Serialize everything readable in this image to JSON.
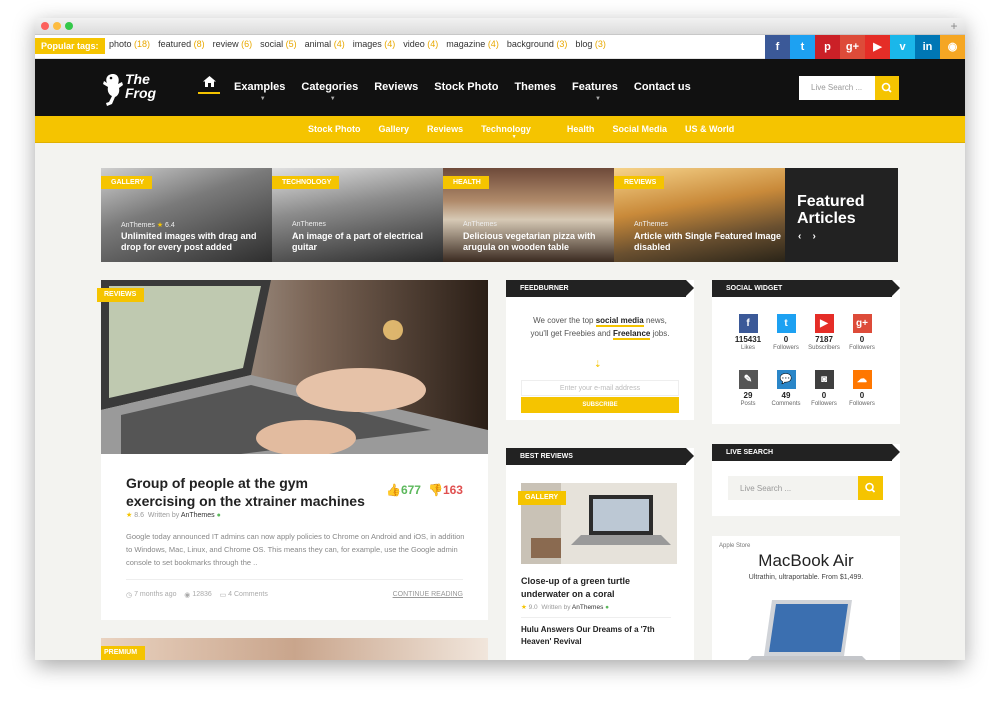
{
  "browser": {
    "new_tab": "+"
  },
  "topbar": {
    "popular_label": "Popular tags:",
    "tags": [
      {
        "name": "photo",
        "count": "(18)"
      },
      {
        "name": "featured",
        "count": "(8)"
      },
      {
        "name": "review",
        "count": "(6)"
      },
      {
        "name": "social",
        "count": "(5)"
      },
      {
        "name": "animal",
        "count": "(4)"
      },
      {
        "name": "images",
        "count": "(4)"
      },
      {
        "name": "video",
        "count": "(4)"
      },
      {
        "name": "magazine",
        "count": "(4)"
      },
      {
        "name": "background",
        "count": "(3)"
      },
      {
        "name": "blog",
        "count": "(3)"
      }
    ],
    "social_icons": [
      {
        "name": "facebook-icon",
        "glyph": "f",
        "color": "#3b5998"
      },
      {
        "name": "twitter-icon",
        "glyph": "t",
        "color": "#1da1f2"
      },
      {
        "name": "pinterest-icon",
        "glyph": "p",
        "color": "#cb2027"
      },
      {
        "name": "google-plus-icon",
        "glyph": "g+",
        "color": "#dd4b39"
      },
      {
        "name": "youtube-icon",
        "glyph": "▶",
        "color": "#e52d27"
      },
      {
        "name": "vimeo-icon",
        "glyph": "v",
        "color": "#1ab7ea"
      },
      {
        "name": "linkedin-icon",
        "glyph": "in",
        "color": "#0077b5"
      },
      {
        "name": "rss-icon",
        "glyph": "◉",
        "color": "#f5a623"
      }
    ]
  },
  "header": {
    "logo_line1": "The",
    "logo_line2": "Frog",
    "nav": [
      "Examples",
      "Categories",
      "Reviews",
      "Stock Photo",
      "Themes",
      "Features",
      "Contact us"
    ],
    "search_placeholder": "Live Search ..."
  },
  "subnav": [
    "Stock Photo",
    "Gallery",
    "Reviews",
    "Technology",
    "Health",
    "Social Media",
    "US & World"
  ],
  "featured": {
    "heading_line1": "Featured",
    "heading_line2": "Articles",
    "prev": "‹",
    "next": "›",
    "cards": [
      {
        "label": "GALLERY",
        "author": "AnThemes",
        "rating": "6.4",
        "title": "Unlimited images with drag and drop for every post added"
      },
      {
        "label": "TECHNOLOGY",
        "author": "AnThemes",
        "rating": "",
        "title": "An image of a part of electrical guitar"
      },
      {
        "label": "HEALTH",
        "author": "AnThemes",
        "rating": "",
        "title": "Delicious vegetarian pizza with arugula on wooden table"
      },
      {
        "label": "REVIEWS",
        "author": "AnThemes",
        "rating": "",
        "title": "Article with Single Featured Image disabled"
      }
    ]
  },
  "post": {
    "label": "REVIEWS",
    "title": "Group of people at the gym exercising on the xtrainer machines",
    "likes": "677",
    "dislikes": "163",
    "rating": "8.6",
    "written_by": "Written by",
    "author": "AnThemes",
    "excerpt": "Google today announced IT admins can now apply policies to Chrome on Android and iOS, in addition to Windows, Mac, Linux, and Chrome OS. This means they can, for example, use the Google admin console to set bookmarks through the ..",
    "time": "7 months ago",
    "views": "12836",
    "comments": "4 Comments",
    "read_more": "CONTINUE READING",
    "next_label": "PREMIUM"
  },
  "feedburner": {
    "title": "FEEDBURNER",
    "text_a": "We cover the top ",
    "text_b": "social media",
    "text_c": " news, you'll get Freebies and ",
    "text_d": "Freelance",
    "text_e": " jobs.",
    "placeholder": "Enter your e-mail address",
    "button": "SUBSCRIBE"
  },
  "best_reviews": {
    "title": "BEST REVIEWS",
    "label": "GALLERY",
    "item_title": "Close-up of a green turtle underwater on a coral",
    "rating": "9.0",
    "written_by": "Written by",
    "author": "AnThemes",
    "item2_title": "Hulu Answers Our Dreams of a '7th Heaven' Revival"
  },
  "social_widget": {
    "title": "SOCIAL WIDGET",
    "items": [
      {
        "icon": "facebook-icon",
        "glyph": "f",
        "color": "#3b5998",
        "count": "115431",
        "label": "Likes"
      },
      {
        "icon": "twitter-icon",
        "glyph": "t",
        "color": "#1da1f2",
        "count": "0",
        "label": "Followers"
      },
      {
        "icon": "youtube-icon",
        "glyph": "▶",
        "color": "#e52d27",
        "count": "7187",
        "label": "Subscribers"
      },
      {
        "icon": "google-plus-icon",
        "glyph": "g+",
        "color": "#dd4b39",
        "count": "0",
        "label": "Followers"
      },
      {
        "icon": "pencil-icon",
        "glyph": "✎",
        "color": "#555555",
        "count": "29",
        "label": "Posts"
      },
      {
        "icon": "comment-icon",
        "glyph": "💬",
        "color": "#2a86c8",
        "count": "49",
        "label": "Comments"
      },
      {
        "icon": "instagram-icon",
        "glyph": "◙",
        "color": "#3f3f3f",
        "count": "0",
        "label": "Followers"
      },
      {
        "icon": "soundcloud-icon",
        "glyph": "☁",
        "color": "#ff7700",
        "count": "0",
        "label": "Followers"
      }
    ]
  },
  "live_search": {
    "title": "LIVE SEARCH",
    "placeholder": "Live Search ..."
  },
  "ad": {
    "store": "Apple Store",
    "product": "MacBook Air",
    "tagline": "Ultrathin, ultraportable. From $1,499."
  },
  "colors": {
    "accent": "#f5c400",
    "dark": "#111111"
  }
}
